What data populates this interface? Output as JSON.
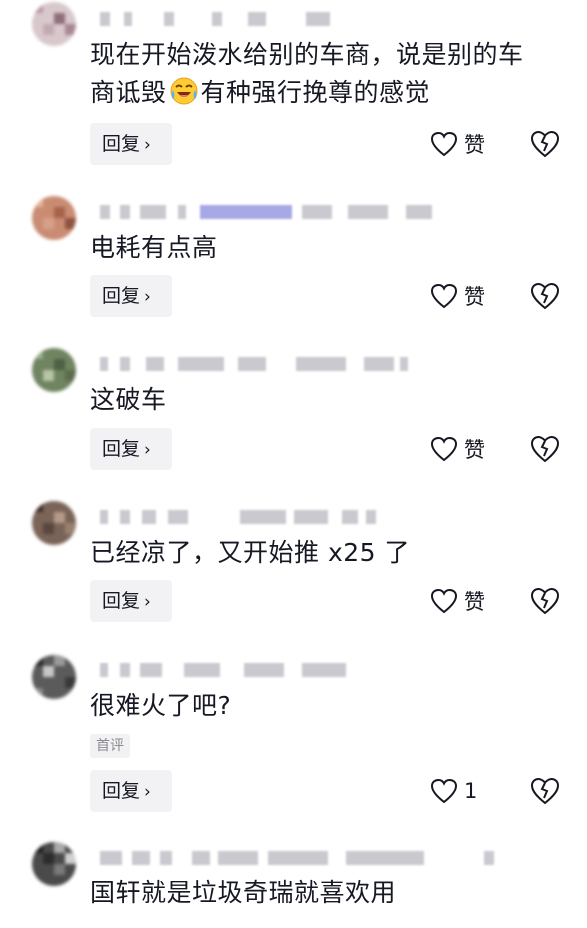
{
  "comments": [
    {
      "text_line1": "现在开始泼水给别的车商，说是别的车",
      "text_line2a": "商诋毁",
      "text_line2b": "有种强行挽尊的感觉",
      "reply_label": "回复",
      "like_label": "赞"
    },
    {
      "text": "电耗有点高",
      "reply_label": "回复",
      "like_label": "赞"
    },
    {
      "text": "这破车",
      "reply_label": "回复",
      "like_label": "赞"
    },
    {
      "text": "已经凉了，又开始推 x25 了",
      "reply_label": "回复",
      "like_label": "赞"
    },
    {
      "text": "很难火了吧?",
      "badge": "首评",
      "reply_label": "回复",
      "like_label": "1"
    },
    {
      "text": "国轩就是垃圾奇瑞就喜欢用"
    }
  ],
  "icons": {
    "emoji": "laughing-crying-emoji",
    "like": "heart-outline-icon",
    "dislike": "broken-heart-icon"
  },
  "colors": {
    "text": "#161823",
    "button_bg": "#f2f2f4",
    "muted": "#8a8b91",
    "icon": "#161823"
  }
}
